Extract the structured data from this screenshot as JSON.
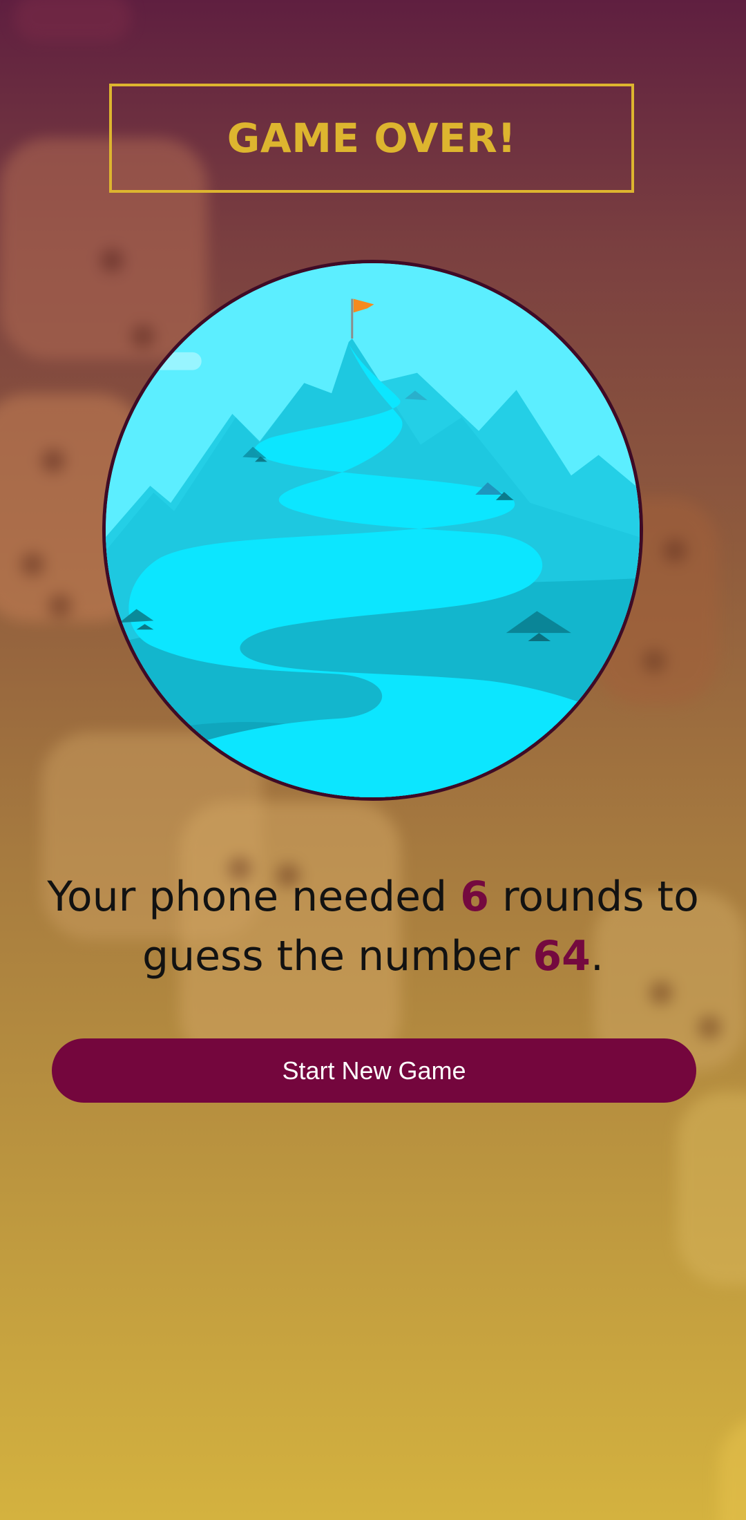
{
  "title": "GAME OVER!",
  "summary": {
    "part1": "Your phone needed ",
    "rounds": "6",
    "part2": " rounds to guess the number ",
    "number": "64",
    "part3": "."
  },
  "start_button_label": "Start New Game",
  "image": {
    "name": "mountain-with-flag-summit",
    "description_icon": "flag-icon"
  },
  "colors": {
    "accent": "#ddb52f",
    "primary": "#74063d",
    "highlight": "#74093f",
    "circle_border": "#3e0b26"
  }
}
